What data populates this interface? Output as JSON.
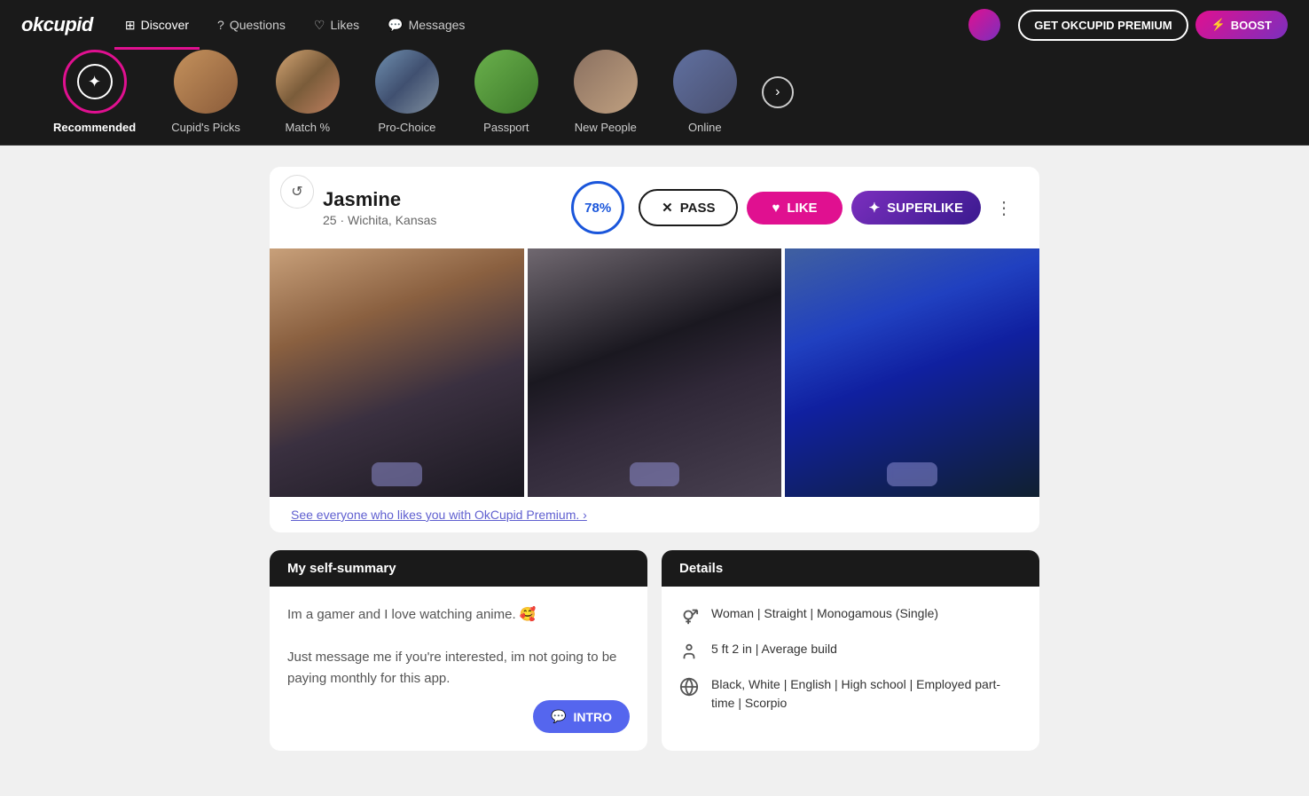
{
  "app": {
    "logo": "okcupid",
    "nav": {
      "items": [
        {
          "id": "discover",
          "label": "Discover",
          "active": true
        },
        {
          "id": "questions",
          "label": "Questions",
          "active": false
        },
        {
          "id": "likes",
          "label": "Likes",
          "active": false
        },
        {
          "id": "messages",
          "label": "Messages",
          "active": false
        }
      ],
      "btn_premium": "GET OKCUPID PREMIUM",
      "btn_boost": "BOOST"
    }
  },
  "categories": [
    {
      "id": "recommended",
      "label": "Recommended",
      "type": "recommended",
      "active": true
    },
    {
      "id": "cupids-picks",
      "label": "Cupid's Picks",
      "type": "t1",
      "active": false
    },
    {
      "id": "match",
      "label": "Match %",
      "type": "t2",
      "active": false
    },
    {
      "id": "pro-choice",
      "label": "Pro-Choice",
      "type": "t3",
      "active": false
    },
    {
      "id": "passport",
      "label": "Passport",
      "type": "t4",
      "active": false
    },
    {
      "id": "new-people",
      "label": "New People",
      "type": "t5",
      "active": false
    },
    {
      "id": "online",
      "label": "Online",
      "type": "t6",
      "active": false
    }
  ],
  "profile": {
    "name": "Jasmine",
    "age": "25",
    "location": "Wichita, Kansas",
    "age_location": "25 · Wichita, Kansas",
    "match_percent": "78%",
    "btn_pass": "PASS",
    "btn_like": "LIKE",
    "btn_superlike": "SUPERLIKE",
    "premium_link": "See everyone who likes you with OkCupid Premium. ›",
    "self_summary": {
      "header": "My self-summary",
      "text": "Im a gamer and I love watching anime. 🥰\n\nJust message me if you're interested, im not going to be paying monthly for this app.",
      "btn_intro": "INTRO"
    },
    "details": {
      "header": "Details",
      "rows": [
        {
          "icon": "gender",
          "text": "Woman | Straight | Monogamous (Single)"
        },
        {
          "icon": "height",
          "text": "5 ft 2 in | Average build"
        },
        {
          "icon": "globe",
          "text": "Black, White | English | High school | Employed part-time | Scorpio"
        }
      ]
    }
  }
}
